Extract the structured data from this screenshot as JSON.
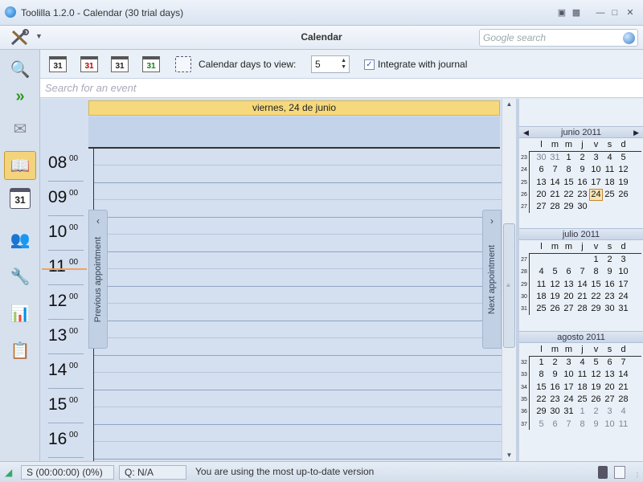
{
  "window": {
    "title": "Toolilla 1.2.0 - Calendar (30 trial days)"
  },
  "toolbar": {
    "section_title": "Calendar",
    "search_placeholder": "Google search"
  },
  "calendar_toolbar": {
    "view_buttons": [
      "31",
      "31",
      "31",
      "31"
    ],
    "days_label": "Calendar days to view:",
    "days_value": "5",
    "journal_checked": true,
    "journal_label": "Integrate with journal"
  },
  "event_search": {
    "placeholder": "Search for an event"
  },
  "day_view": {
    "header": "viernes, 24 de junio",
    "hours": [
      "08",
      "09",
      "10",
      "11",
      "12",
      "13",
      "14",
      "15",
      "16"
    ],
    "minutes": "00",
    "current_hour": "11",
    "prev_label": "Previous appointment",
    "next_label": "Next appointment"
  },
  "minical": {
    "weekdays": [
      "l",
      "m",
      "m",
      "j",
      "v",
      "s",
      "d"
    ],
    "months": [
      {
        "name": "junio 2011",
        "weeks": [
          "23",
          "24",
          "25",
          "26",
          "27"
        ],
        "rows": [
          [
            "30",
            "31",
            "1",
            "2",
            "3",
            "4",
            "5"
          ],
          [
            "6",
            "7",
            "8",
            "9",
            "10",
            "11",
            "12"
          ],
          [
            "13",
            "14",
            "15",
            "16",
            "17",
            "18",
            "19"
          ],
          [
            "20",
            "21",
            "22",
            "23",
            "24",
            "25",
            "26"
          ],
          [
            "27",
            "28",
            "29",
            "30",
            "",
            "",
            ""
          ]
        ],
        "other": [
          [
            0,
            0
          ],
          [
            0,
            1
          ]
        ],
        "today": [
          3,
          4
        ]
      },
      {
        "name": "julio 2011",
        "weeks": [
          "27",
          "28",
          "29",
          "30",
          "31"
        ],
        "rows": [
          [
            "",
            "",
            "",
            "",
            "1",
            "2",
            "3"
          ],
          [
            "4",
            "5",
            "6",
            "7",
            "8",
            "9",
            "10"
          ],
          [
            "11",
            "12",
            "13",
            "14",
            "15",
            "16",
            "17"
          ],
          [
            "18",
            "19",
            "20",
            "21",
            "22",
            "23",
            "24"
          ],
          [
            "25",
            "26",
            "27",
            "28",
            "29",
            "30",
            "31"
          ]
        ],
        "other": [],
        "today": null
      },
      {
        "name": "agosto 2011",
        "weeks": [
          "32",
          "33",
          "34",
          "35",
          "36",
          "37"
        ],
        "rows": [
          [
            "1",
            "2",
            "3",
            "4",
            "5",
            "6",
            "7"
          ],
          [
            "8",
            "9",
            "10",
            "11",
            "12",
            "13",
            "14"
          ],
          [
            "15",
            "16",
            "17",
            "18",
            "19",
            "20",
            "21"
          ],
          [
            "22",
            "23",
            "24",
            "25",
            "26",
            "27",
            "28"
          ],
          [
            "29",
            "30",
            "31",
            "1",
            "2",
            "3",
            "4"
          ],
          [
            "5",
            "6",
            "7",
            "8",
            "9",
            "10",
            "11"
          ]
        ],
        "other": [
          [
            4,
            3
          ],
          [
            4,
            4
          ],
          [
            4,
            5
          ],
          [
            4,
            6
          ],
          [
            5,
            0
          ],
          [
            5,
            1
          ],
          [
            5,
            2
          ],
          [
            5,
            3
          ],
          [
            5,
            4
          ],
          [
            5,
            5
          ],
          [
            5,
            6
          ]
        ],
        "today": null
      }
    ]
  },
  "statusbar": {
    "sync": "S (00:00:00) (0%)",
    "queue": "Q: N/A",
    "message": "You are using the most up-to-date version"
  },
  "colors": {
    "accent": "#f6d97c",
    "today_border": "#c5862a",
    "now_line": "#f3a35c"
  }
}
